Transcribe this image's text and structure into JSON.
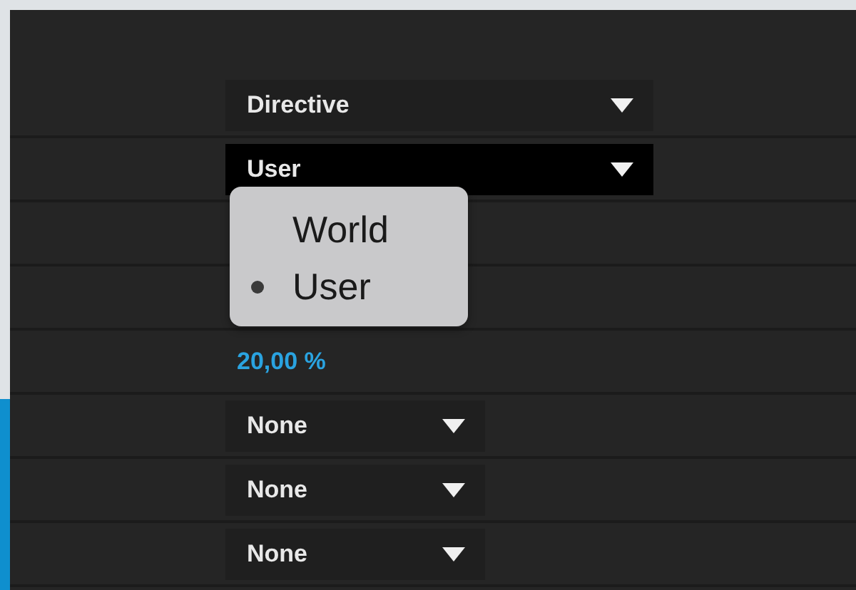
{
  "rows": [
    {
      "kind": "dropdown",
      "value": "Directive",
      "open": false
    },
    {
      "kind": "dropdown",
      "value": "User",
      "open": true,
      "menu": [
        {
          "label": "World",
          "selected": false
        },
        {
          "label": "User",
          "selected": true
        }
      ]
    },
    {
      "kind": "blank"
    },
    {
      "kind": "blank"
    },
    {
      "kind": "number",
      "value": "20,00 %"
    },
    {
      "kind": "short-dropdown",
      "value": "None",
      "open": false
    },
    {
      "kind": "short-dropdown",
      "value": "None",
      "open": false
    },
    {
      "kind": "short-dropdown",
      "value": "None",
      "open": false
    }
  ]
}
